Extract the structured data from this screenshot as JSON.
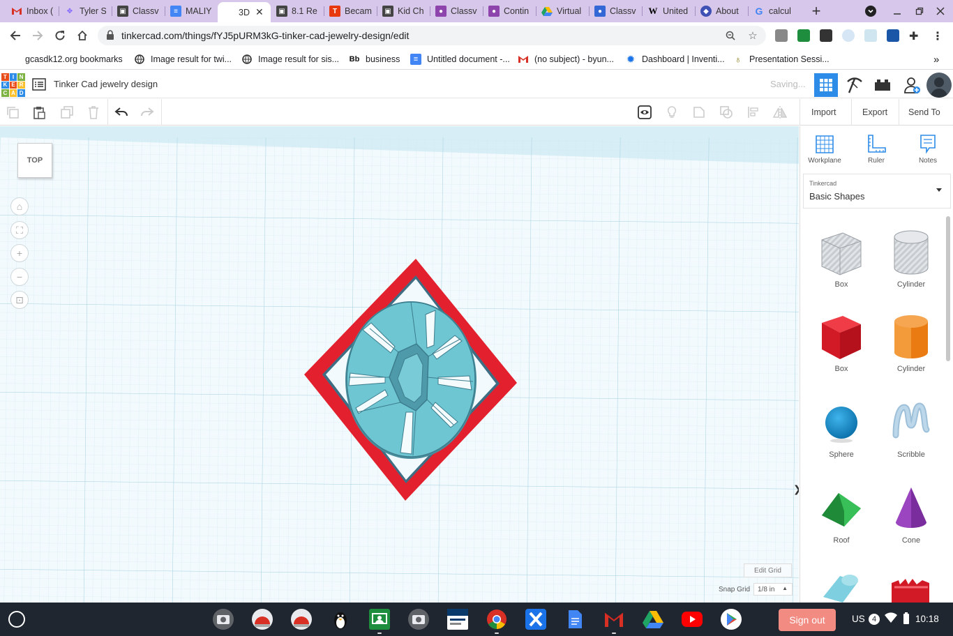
{
  "browser": {
    "tabs": [
      {
        "title": "Inbox (",
        "icon": "gmail-icon",
        "color": "#d93025",
        "active": false
      },
      {
        "title": "Tyler S",
        "icon": "figma-like-icon",
        "color": "#7b61ff",
        "active": false
      },
      {
        "title": "Classv",
        "icon": "classroom-icon",
        "color": "#444444",
        "active": false
      },
      {
        "title": "MALIY",
        "icon": "docs-icon",
        "color": "#4285f4",
        "active": false
      },
      {
        "title": "3D",
        "icon": "tinkercad-icon",
        "color": "#e84e1b",
        "active": true
      },
      {
        "title": "8.1 Re",
        "icon": "classroom-icon",
        "color": "#444444",
        "active": false
      },
      {
        "title": "Becam",
        "icon": "t-icon",
        "color": "#e8380d",
        "active": false
      },
      {
        "title": "Kid Ch",
        "icon": "classroom-icon",
        "color": "#444444",
        "active": false
      },
      {
        "title": "Classv",
        "icon": "person-icon",
        "color": "#8e44ad",
        "active": false
      },
      {
        "title": "Contin",
        "icon": "person-icon",
        "color": "#8e44ad",
        "active": false
      },
      {
        "title": "Virtual",
        "icon": "drive-icon",
        "color": "#1fa463",
        "active": false
      },
      {
        "title": "Classv",
        "icon": "person-icon",
        "color": "#3367d6",
        "active": false
      },
      {
        "title": "United",
        "icon": "wikipedia-icon",
        "color": "#000000",
        "active": false
      },
      {
        "title": "About",
        "icon": "globe-icon",
        "color": "#3f51b5",
        "active": false
      },
      {
        "title": "calcul",
        "icon": "google-icon",
        "color": "#4285f4",
        "active": false
      }
    ],
    "new_tab": "+",
    "url": "tinkercad.com/things/fYJ5pURM3kG-tinker-cad-jewelry-design/edit",
    "bookmarks": [
      {
        "label": "gcasdk12.org bookmarks",
        "icon": "folder-icon"
      },
      {
        "label": "Image result for twi...",
        "icon": "globe-icon"
      },
      {
        "label": "Image result for sis...",
        "icon": "globe-icon"
      },
      {
        "label": "business",
        "icon": "bb-icon"
      },
      {
        "label": "Untitled document -...",
        "icon": "docs-icon"
      },
      {
        "label": "(no subject) - byun...",
        "icon": "gmail-icon"
      },
      {
        "label": "Dashboard | Inventi...",
        "icon": "gear-icon"
      },
      {
        "label": "Presentation Sessi...",
        "icon": "bag-icon"
      }
    ],
    "bookmarks_more": "»"
  },
  "tinkercad": {
    "logo_letters": [
      "T",
      "I",
      "N",
      "K",
      "E",
      "R",
      "C",
      "A",
      "D"
    ],
    "design_title": "Tinker Cad jewelry design",
    "save_status": "Saving...",
    "toolbar": {
      "import_label": "Import",
      "export_label": "Export",
      "send_to_label": "Send To"
    },
    "viewcube_label": "TOP",
    "edit_grid_label": "Edit Grid",
    "snap_grid_label": "Snap Grid",
    "snap_grid_value": "1/8 in",
    "panel": {
      "tools": [
        {
          "label": "Workplane",
          "icon": "workplane-icon"
        },
        {
          "label": "Ruler",
          "icon": "ruler-icon"
        },
        {
          "label": "Notes",
          "icon": "notes-icon"
        }
      ],
      "library_small": "Tinkercad",
      "library_selected": "Basic Shapes",
      "shapes": [
        {
          "label": "Box",
          "icon": "striped-box-icon"
        },
        {
          "label": "Cylinder",
          "icon": "striped-cylinder-icon"
        },
        {
          "label": "Box",
          "icon": "red-box-icon"
        },
        {
          "label": "Cylinder",
          "icon": "orange-cylinder-icon"
        },
        {
          "label": "Sphere",
          "icon": "sphere-icon"
        },
        {
          "label": "Scribble",
          "icon": "scribble-icon"
        },
        {
          "label": "Roof",
          "icon": "roof-icon"
        },
        {
          "label": "Cone",
          "icon": "cone-icon"
        }
      ]
    }
  },
  "taskbar": {
    "sign_out_label": "Sign out",
    "keyboard_layout": "US",
    "notification_count": "4",
    "time": "10:18"
  },
  "colors": {
    "tab_strip": "#d7c7ea",
    "tinkercad_blue": "#2d8ce8",
    "red_shape": "#e3202e",
    "teal_shape": "#6ec6d3",
    "grid_background": "#eef8fc"
  }
}
